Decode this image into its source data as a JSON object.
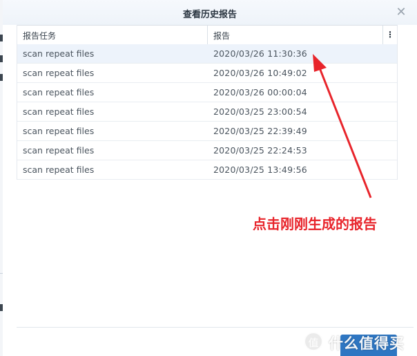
{
  "dialog": {
    "title": "查看历史报告",
    "close_glyph": "✕",
    "menu_glyph": "⋮"
  },
  "columns": {
    "task": "报告任务",
    "report": "报告"
  },
  "rows": [
    {
      "task": "scan repeat files",
      "report": "2020/03/26 11:30:36",
      "selected": true
    },
    {
      "task": "scan repeat files",
      "report": "2020/03/26 10:49:02"
    },
    {
      "task": "scan repeat files",
      "report": "2020/03/26 00:00:04"
    },
    {
      "task": "scan repeat files",
      "report": "2020/03/25 23:00:54"
    },
    {
      "task": "scan repeat files",
      "report": "2020/03/25 22:39:49"
    },
    {
      "task": "scan repeat files",
      "report": "2020/03/25 22:24:53"
    },
    {
      "task": "scan repeat files",
      "report": "2020/03/25 13:49:56"
    }
  ],
  "annotation": {
    "text": "点击刚刚生成的报告",
    "color": "#e8242b"
  },
  "watermark": {
    "logo": "值",
    "text": "什么值得买"
  },
  "colors": {
    "accent": "#2e76c2",
    "selected_row": "#edf3fb"
  }
}
